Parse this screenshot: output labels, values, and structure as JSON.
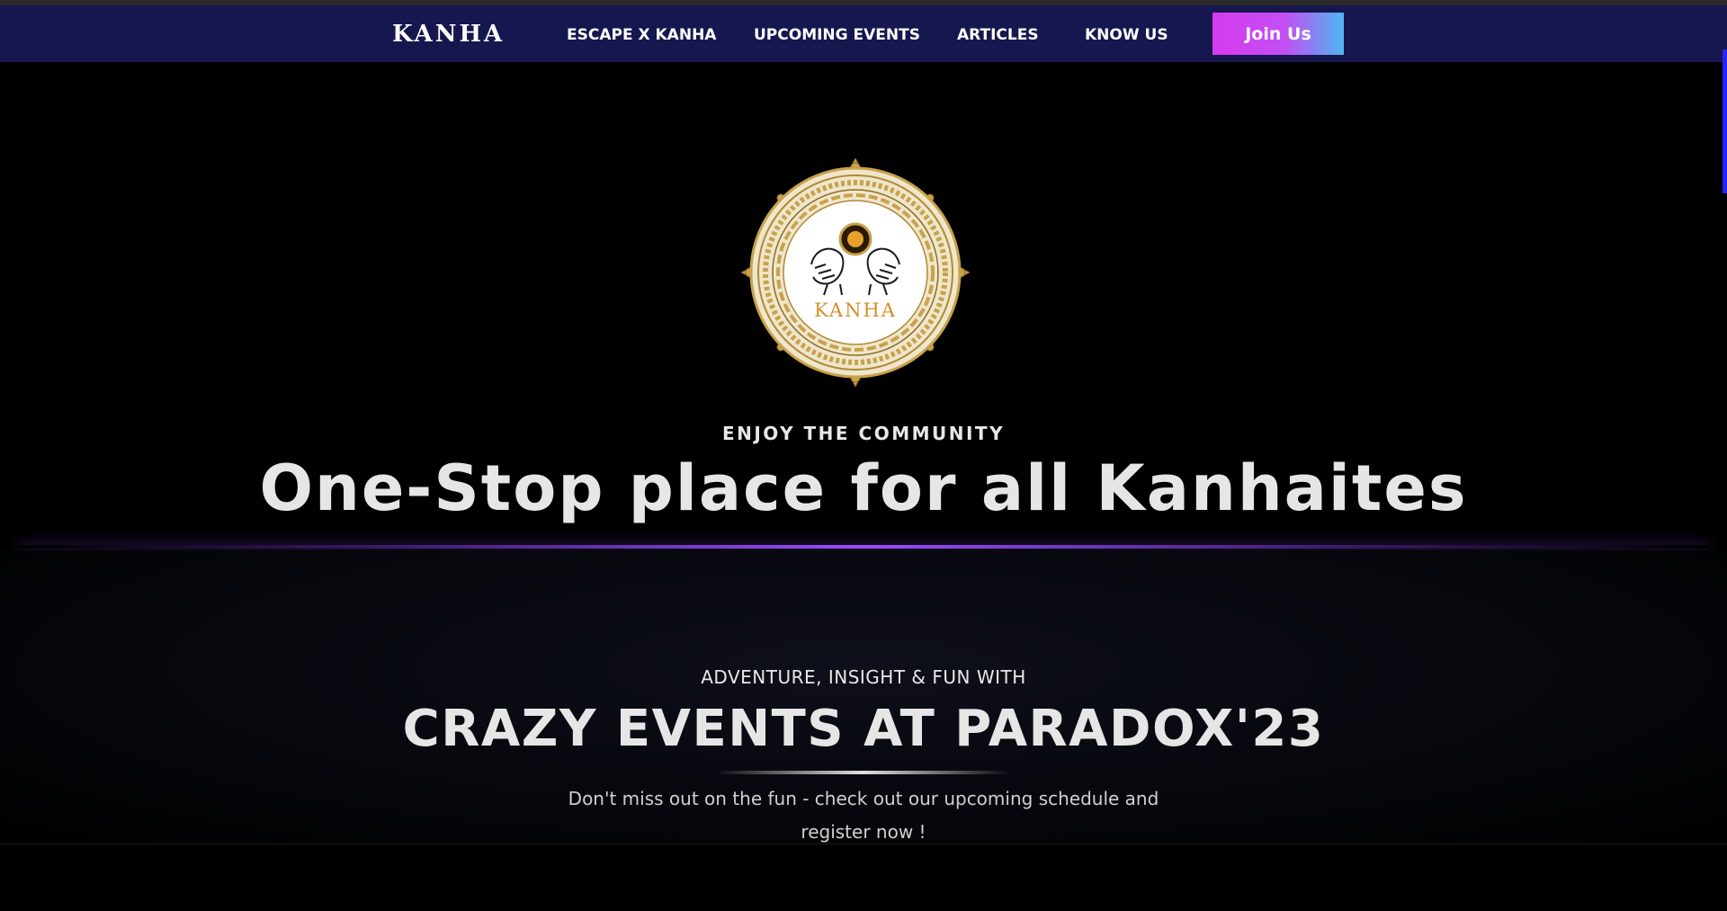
{
  "header": {
    "brand": "KANHA",
    "nav": [
      {
        "label": "ESCAPE X KANHA"
      },
      {
        "label": "UPCOMING EVENTS"
      },
      {
        "label": "ARTICLES"
      },
      {
        "label": "KNOW US"
      }
    ],
    "cta_label": "Join Us"
  },
  "hero": {
    "logo_text": "KANHA",
    "kicker": "ENJOY THE COMMUNITY",
    "title": "One-Stop place for all Kanhaites"
  },
  "events": {
    "kicker": "ADVENTURE, INSIGHT & FUN WITH",
    "title": "CRAZY EVENTS AT PARADOX'23",
    "description": "Don't miss out on the fun - check out our upcoming schedule and register now !"
  },
  "colors": {
    "header_bg": "#16174f",
    "accent_purple": "#9b4dff",
    "cta_gradient_start": "#d63af0",
    "cta_gradient_end": "#4fb6f0",
    "logo_gold": "#c8a24a"
  }
}
